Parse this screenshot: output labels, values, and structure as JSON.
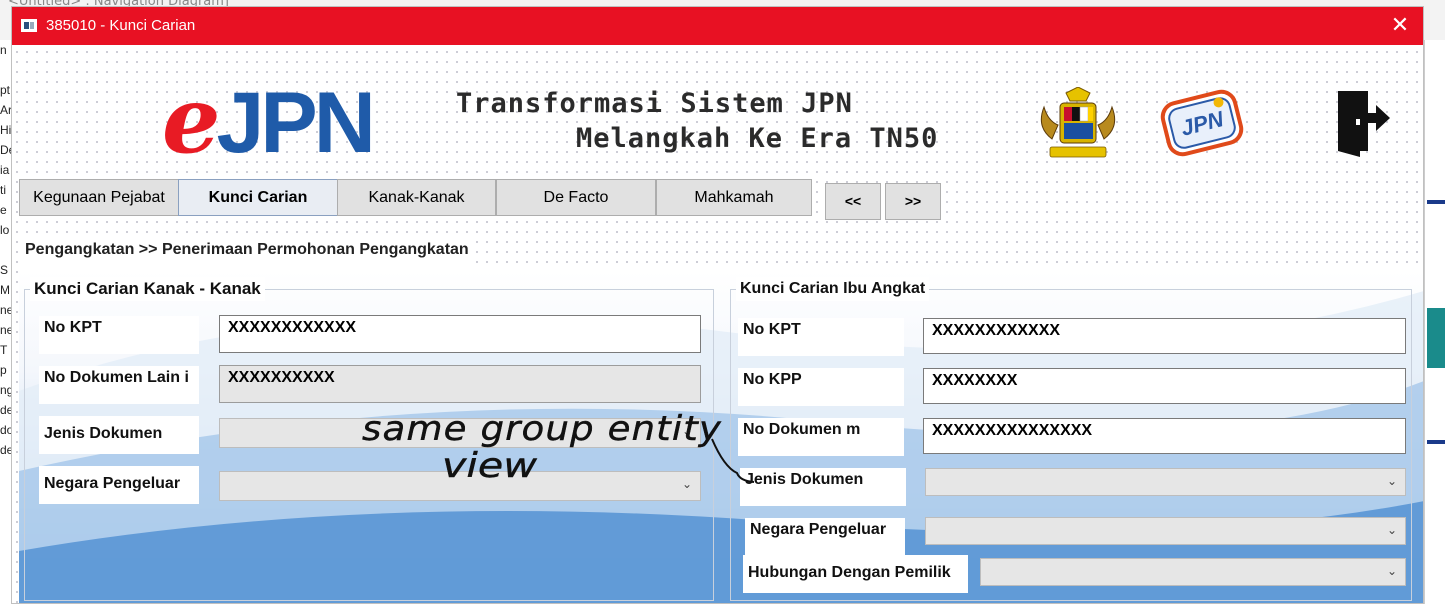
{
  "background_app": {
    "title": "<Untitled> : Navigation Diagram]",
    "left_fragments": [
      "n",
      "",
      "pt",
      "Ar",
      "Hi",
      "De",
      "ia",
      "ti",
      "e C",
      "lo",
      "",
      "S",
      "M",
      "ne",
      "ne",
      "T",
      "p",
      "ng",
      "de",
      "do",
      "de"
    ]
  },
  "window": {
    "title": "385010 - Kunci Carian",
    "close_glyph": "✕"
  },
  "header": {
    "logo_e": "e",
    "logo_jpn": "JPN",
    "slogan_line1": "Transformasi Sistem JPN",
    "slogan_line2": "Melangkah Ke Era TN50",
    "badge_text": "JPN"
  },
  "tabs": [
    {
      "label": "Kegunaan Pejabat",
      "active": false
    },
    {
      "label": "Kunci Carian",
      "active": true
    },
    {
      "label": "Kanak-Kanak",
      "active": false
    },
    {
      "label": "De Facto",
      "active": false
    },
    {
      "label": "Mahkamah",
      "active": false
    }
  ],
  "nav": {
    "prev": "<<",
    "next": ">>"
  },
  "breadcrumb": "Pengangkatan >> Penerimaan Permohonan Pengangkatan",
  "left_group": {
    "title": "Kunci Carian Kanak - Kanak",
    "fields": [
      {
        "label": "No KPT",
        "value": "XXXXXXXXXXXX"
      },
      {
        "label": "No Dokumen Lain i",
        "value": "XXXXXXXXXX"
      },
      {
        "label": "Jenis Dokumen",
        "value": ""
      },
      {
        "label": "Negara Pengeluar",
        "value": ""
      }
    ]
  },
  "right_group": {
    "title": "Kunci Carian Ibu Angkat",
    "fields": [
      {
        "label": "No KPT",
        "value": "XXXXXXXXXXXX"
      },
      {
        "label": "No KPP",
        "value": "XXXXXXXX"
      },
      {
        "label": "No Dokumen m",
        "value": "XXXXXXXXXXXXXXX"
      },
      {
        "label": "Jenis Dokumen",
        "value": ""
      },
      {
        "label": "Negara Pengeluar",
        "value": ""
      },
      {
        "label": "Hubungan Dengan Pemilik",
        "value": ""
      }
    ]
  },
  "annotation": {
    "line1": "same group entity",
    "line2": "view"
  },
  "colors": {
    "titlebar": "#e81123",
    "logo_red": "#e81b24",
    "logo_blue": "#1f5ba9"
  }
}
